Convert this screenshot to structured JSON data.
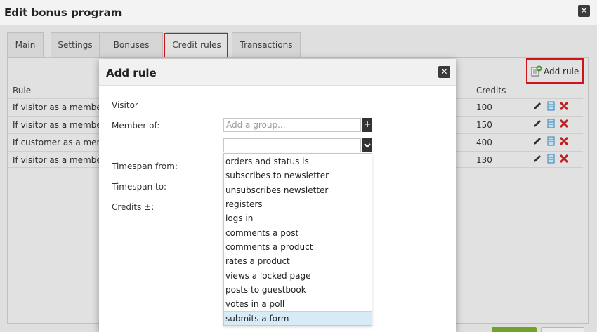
{
  "window": {
    "title": "Edit bonus program"
  },
  "tabs": [
    {
      "label": "Main"
    },
    {
      "label": "Settings"
    },
    {
      "label": "Bonuses"
    },
    {
      "label": "Credit rules"
    },
    {
      "label": "Transactions"
    }
  ],
  "toolbar": {
    "add_rule_label": "Add rule"
  },
  "table": {
    "headers": {
      "rule": "Rule",
      "credits": "Credits"
    },
    "rows": [
      {
        "rule": "If visitor as a member of",
        "credits": "100"
      },
      {
        "rule": "If visitor as a member of",
        "credits": "150"
      },
      {
        "rule": "If customer as a member",
        "credits": "400"
      },
      {
        "rule": "If visitor as a member of",
        "credits": "130"
      }
    ]
  },
  "modal": {
    "title": "Add rule",
    "visitor_label": "Visitor",
    "member_of_label": "Member of:",
    "group_placeholder": "Add a group...",
    "timespan_from_label": "Timespan from:",
    "timespan_to_label": "Timespan to:",
    "credits_label": "Credits ±:",
    "action_options": [
      "orders and status is",
      "subscribes to newsletter",
      "unsubscribes newsletter",
      "registers",
      "logs in",
      "comments a post",
      "comments a product",
      "rates a product",
      "views a locked page",
      "posts to guestbook",
      "votes in a poll",
      "submits a form"
    ],
    "selected_option": "submits a form"
  },
  "colors": {
    "highlight": "#e0161b",
    "selected_row": "#d7ebf7",
    "delete": "#d0201f",
    "copy": "#2a8fd0",
    "accept": "#7ab02e"
  }
}
